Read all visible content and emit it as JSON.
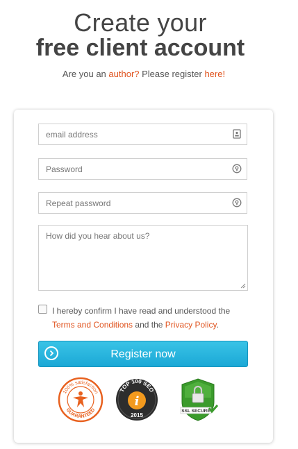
{
  "header": {
    "title_line1": "Create your",
    "title_line2": "free client account",
    "subtitle_prefix": "Are you an ",
    "subtitle_author_link": "author?",
    "subtitle_middle": " Please register ",
    "subtitle_here_link": "here!"
  },
  "form": {
    "email_placeholder": "email address",
    "email_icon": "contact-card-icon",
    "password_placeholder": "Password",
    "password_icon": "lock-icon",
    "repeat_password_placeholder": "Repeat password",
    "repeat_password_icon": "lock-icon",
    "referral_placeholder": "How did you hear about us?",
    "confirm_text_1": "I hereby confirm I have read and understood the",
    "terms_link": "Terms and Conditions",
    "confirm_text_2": " and the ",
    "privacy_link": "Privacy Policy",
    "confirm_text_3": ".",
    "register_label": "Register now",
    "register_icon": "chevron-right-circle-icon"
  },
  "badges": {
    "satisfaction_top": "100% satisfaction",
    "satisfaction_bottom": "GUARANTEED",
    "seo_top": "TOP 100 SEO",
    "seo_year": "2015",
    "ssl_label": "SSL SECURE"
  },
  "colors": {
    "accent_link": "#e0541f",
    "button_blue": "#1ba8d6",
    "badge_orange": "#e8611f",
    "ssl_green": "#3b9b2c"
  }
}
